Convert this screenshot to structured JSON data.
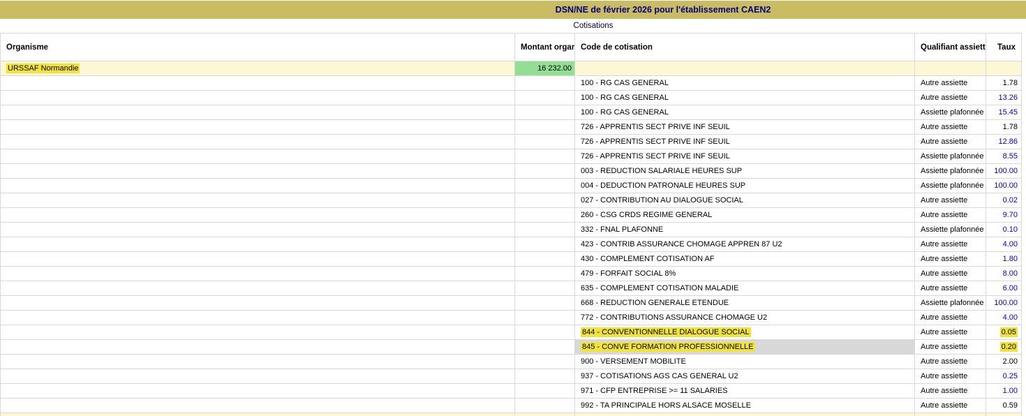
{
  "title": "DSN/NE de février 2026 pour l'établissement CAEN2",
  "section_title": "Cotisations",
  "colors": {
    "title_bar": "#c9bc62",
    "title_text": "#000080",
    "row_yellow": "#fcf7d5",
    "highlight_yellow": "#f2e33c",
    "montant_green": "#92de92",
    "taux_blue": "#0000c8",
    "selected_gray": "#d8d8d8",
    "border": "#d8d8d8"
  },
  "table": {
    "headers": {
      "organisme": "Organisme",
      "montant": "Montant\norganisme",
      "code": "Code de\ncotisation",
      "qualifiant": "Qualifiant\nassiette",
      "taux": "Taux"
    },
    "organisme_row": {
      "organisme": "URSSAF Normandie",
      "montant": "16 232.00"
    },
    "rows": [
      {
        "code": "100 - RG CAS GENERAL",
        "qualifiant": "Autre assiette",
        "taux": "1.78",
        "taux_color": "black"
      },
      {
        "code": "100 - RG CAS GENERAL",
        "qualifiant": "Autre assiette",
        "taux": "13.26",
        "taux_color": "blue"
      },
      {
        "code": "100 - RG CAS GENERAL",
        "qualifiant": "Assiette plafonnée",
        "taux": "15.45",
        "taux_color": "blue"
      },
      {
        "code": "726 - APPRENTIS SECT PRIVE INF SEUIL",
        "qualifiant": "Autre assiette",
        "taux": "1.78",
        "taux_color": "black"
      },
      {
        "code": "726 - APPRENTIS SECT PRIVE INF SEUIL",
        "qualifiant": "Autre assiette",
        "taux": "12.86",
        "taux_color": "blue"
      },
      {
        "code": "726 - APPRENTIS SECT PRIVE INF SEUIL",
        "qualifiant": "Assiette plafonnée",
        "taux": "8.55",
        "taux_color": "blue"
      },
      {
        "code": "003 - REDUCTION SALARIALE HEURES SUP",
        "qualifiant": "Assiette plafonnée",
        "taux": "100.00",
        "taux_color": "blue"
      },
      {
        "code": "004 - DEDUCTION PATRONALE HEURES SUP",
        "qualifiant": "Assiette plafonnée",
        "taux": "100.00",
        "taux_color": "blue"
      },
      {
        "code": "027 - CONTRIBUTION AU DIALOGUE SOCIAL",
        "qualifiant": "Autre assiette",
        "taux": "0.02",
        "taux_color": "blue"
      },
      {
        "code": "260 - CSG CRDS REGIME GENERAL",
        "qualifiant": "Autre assiette",
        "taux": "9.70",
        "taux_color": "blue"
      },
      {
        "code": "332 - FNAL PLAFONNE",
        "qualifiant": "Assiette plafonnée",
        "taux": "0.10",
        "taux_color": "blue"
      },
      {
        "code": "423 - CONTRIB ASSURANCE CHOMAGE APPREN 87 U2",
        "qualifiant": "Autre assiette",
        "taux": "4.00",
        "taux_color": "blue"
      },
      {
        "code": "430 - COMPLEMENT COTISATION AF",
        "qualifiant": "Autre assiette",
        "taux": "1.80",
        "taux_color": "blue"
      },
      {
        "code": "479 - FORFAIT SOCIAL 8%",
        "qualifiant": "Autre assiette",
        "taux": "8.00",
        "taux_color": "blue"
      },
      {
        "code": "635 - COMPLEMENT COTISATION MALADIE",
        "qualifiant": "Autre assiette",
        "taux": "6.00",
        "taux_color": "blue"
      },
      {
        "code": "668 - REDUCTION GENERALE ETENDUE",
        "qualifiant": "Assiette plafonnée",
        "taux": "100.00",
        "taux_color": "blue"
      },
      {
        "code": "772 - CONTRIBUTIONS ASSURANCE CHOMAGE U2",
        "qualifiant": "Autre assiette",
        "taux": "4.00",
        "taux_color": "blue"
      },
      {
        "code": "844 - CONVENTIONNELLE DIALOGUE SOCIAL",
        "qualifiant": "Autre assiette",
        "taux": "0.05",
        "taux_color": "black",
        "highlight": true
      },
      {
        "code": "845 - CONVE FORMATION PROFESSIONNELLE",
        "qualifiant": "Autre assiette",
        "taux": "0.20",
        "taux_color": "black",
        "highlight": true,
        "selected": true
      },
      {
        "code": "900 - VERSEMENT MOBILITE",
        "qualifiant": "Autre assiette",
        "taux": "2.00",
        "taux_color": "black"
      },
      {
        "code": "937 - COTISATIONS AGS CAS GENERAL U2",
        "qualifiant": "Autre assiette",
        "taux": "0.25",
        "taux_color": "blue"
      },
      {
        "code": "971 - CFP ENTREPRISE >= 11 SALARIES",
        "qualifiant": "Autre assiette",
        "taux": "1.00",
        "taux_color": "blue"
      },
      {
        "code": "992 - TA PRINCIPALE HORS ALSACE MOSELLE",
        "qualifiant": "Autre assiette",
        "taux": "0.59",
        "taux_color": "black"
      }
    ]
  }
}
